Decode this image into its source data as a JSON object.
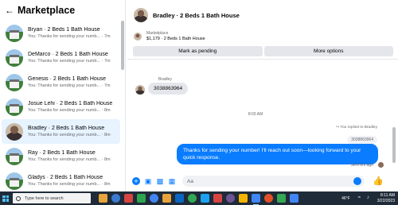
{
  "marketplace": {
    "title": "Marketplace",
    "conversations": [
      {
        "name": "Bryan · 2 Beds 1 Bath House",
        "preview": "You: Thanks for sending your numb... · 7m",
        "avatar": "house"
      },
      {
        "name": "DeMarco · 2 Beds 1 Bath House",
        "preview": "You: Thanks for sending your numb... · 7m",
        "avatar": "house"
      },
      {
        "name": "Genesis · 2 Beds 1 Bath House",
        "preview": "You: Thanks for sending your numb... · 7m",
        "avatar": "house"
      },
      {
        "name": "Josue Lehi · 2 Beds 1 Bath House",
        "preview": "You: Thanks for sending your numb... · 8m",
        "avatar": "house"
      },
      {
        "name": "Bradley · 2 Beds 1 Bath House",
        "preview": "You: Thanks for sending your numb... · 8m",
        "avatar": "person",
        "active": true
      },
      {
        "name": "Ray · 2 Beds 1 Bath House",
        "preview": "You: Thanks for sending your numb... · 8m",
        "avatar": "house"
      },
      {
        "name": "Gladys · 2 Beds 1 Bath House",
        "preview": "You: Thanks for sending your numb... · 8m",
        "avatar": "house"
      }
    ]
  },
  "chat": {
    "title": "Bradley · 2 Beds 1 Bath House",
    "item_label": "Marketplace",
    "item_price": "$1,179 · 2 Beds 1 Bath House",
    "mark_pending": "Mark as pending",
    "more_options": "More options",
    "sender": "Bradley",
    "incoming_message": "3038863964",
    "time_separator": "8:03 AM",
    "replied_label": "You replied to Bradley",
    "quoted_text": "3038863964",
    "outgoing_message": "Thanks for sending your number! I'll reach out soon—looking forward to your quick response.",
    "sent_status": "Sent 8m ago",
    "composer_placeholder": "Aa"
  },
  "taskbar": {
    "search_placeholder": "Type here to search",
    "weather": "46°F",
    "time": "8:11 AM",
    "date": "3/22/2023",
    "app_colors": [
      "#e8a33c",
      "#3b7ad1",
      "#d64541",
      "#2ea44f",
      "#4285f4",
      "#e8a33c",
      "#0a66c2",
      "#34a853",
      "#1da1f2",
      "#d64541",
      "#6e5494",
      "#f4b400",
      "#4285f4",
      "#e34f26",
      "#34a853",
      "#4285f4"
    ]
  },
  "colors": {
    "accent": "#0a7cff",
    "active_conversation": "#e7f3ff",
    "taskbar": "#1f2b38"
  },
  "icons": [
    "back-arrow-icon",
    "plus-icon",
    "image-icon",
    "sticker-icon",
    "gif-icon",
    "emoji-icon",
    "like-icon",
    "windows-icon",
    "search-icon",
    "wifi-icon",
    "volume-icon"
  ]
}
